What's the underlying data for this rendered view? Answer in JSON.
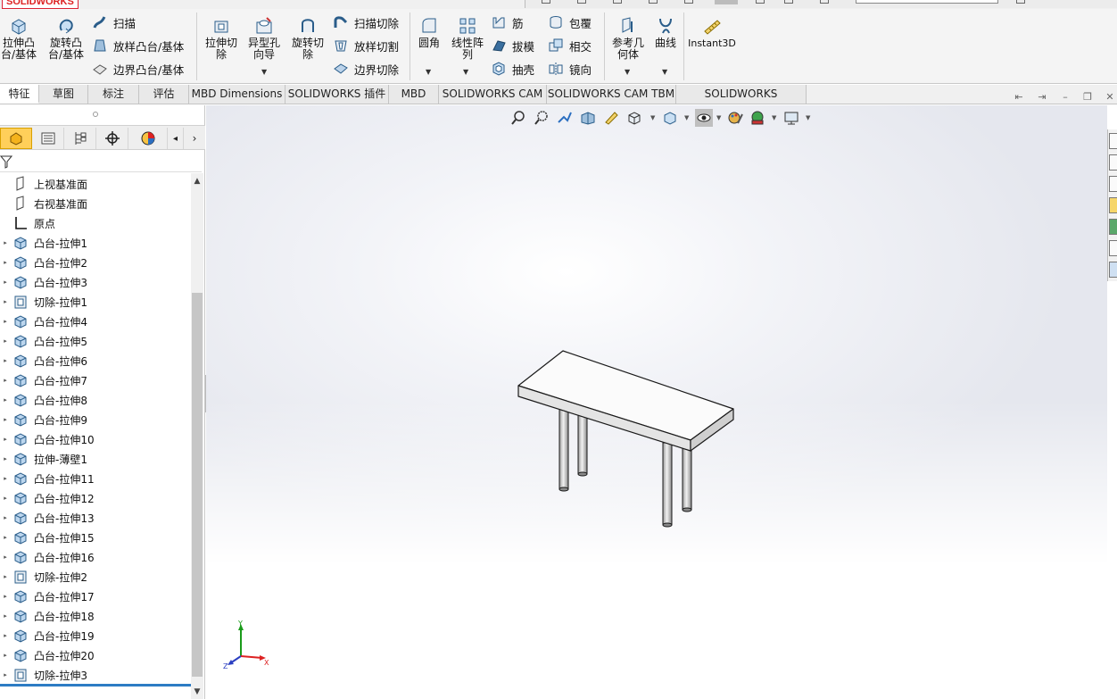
{
  "app": {
    "logo_text": "SOLIDWORKS"
  },
  "commands": {
    "extrude_boss": [
      "拉伸凸",
      "台/基体"
    ],
    "revolve_boss": [
      "旋转凸",
      "台/基体"
    ],
    "sweep": "扫描",
    "loft_boss": "放样凸台/基体",
    "boundary_boss": "边界凸台/基体",
    "extrude_cut": [
      "拉伸切",
      "除"
    ],
    "hole_wizard": [
      "异型孔",
      "向导"
    ],
    "revolve_cut": [
      "旋转切",
      "除"
    ],
    "swept_cut": "扫描切除",
    "lofted_cut": "放样切割",
    "boundary_cut": "边界切除",
    "fillet": "圆角",
    "linear_pattern": [
      "线性阵",
      "列"
    ],
    "rib": "筋",
    "draft": "拔模",
    "shell": "抽壳",
    "wrap": "包覆",
    "intersect": "相交",
    "mirror": "镜向",
    "ref_geometry": [
      "参考几",
      "何体"
    ],
    "curves": "曲线",
    "instant3d": "Instant3D"
  },
  "tabs": [
    "特征",
    "草图",
    "标注",
    "评估",
    "MBD Dimensions",
    "SOLIDWORKS 插件",
    "MBD",
    "SOLIDWORKS CAM",
    "SOLIDWORKS CAM TBM",
    "SOLIDWORKS Inspection"
  ],
  "active_tab": "特征",
  "feature_tree": [
    {
      "label": "上视基准面",
      "icon": "plane-icon"
    },
    {
      "label": "右视基准面",
      "icon": "plane-icon"
    },
    {
      "label": "原点",
      "icon": "origin-icon"
    },
    {
      "label": "凸台-拉伸1",
      "icon": "boss-extrude-icon"
    },
    {
      "label": "凸台-拉伸2",
      "icon": "boss-extrude-icon"
    },
    {
      "label": "凸台-拉伸3",
      "icon": "boss-extrude-icon"
    },
    {
      "label": "切除-拉伸1",
      "icon": "cut-extrude-icon"
    },
    {
      "label": "凸台-拉伸4",
      "icon": "boss-extrude-icon"
    },
    {
      "label": "凸台-拉伸5",
      "icon": "boss-extrude-icon"
    },
    {
      "label": "凸台-拉伸6",
      "icon": "boss-extrude-icon"
    },
    {
      "label": "凸台-拉伸7",
      "icon": "boss-extrude-icon"
    },
    {
      "label": "凸台-拉伸8",
      "icon": "boss-extrude-icon"
    },
    {
      "label": "凸台-拉伸9",
      "icon": "boss-extrude-icon"
    },
    {
      "label": "凸台-拉伸10",
      "icon": "boss-extrude-icon"
    },
    {
      "label": "拉伸-薄壁1",
      "icon": "boss-extrude-icon"
    },
    {
      "label": "凸台-拉伸11",
      "icon": "boss-extrude-icon"
    },
    {
      "label": "凸台-拉伸12",
      "icon": "boss-extrude-icon"
    },
    {
      "label": "凸台-拉伸13",
      "icon": "boss-extrude-icon"
    },
    {
      "label": "凸台-拉伸15",
      "icon": "boss-extrude-icon"
    },
    {
      "label": "凸台-拉伸16",
      "icon": "boss-extrude-icon"
    },
    {
      "label": "切除-拉伸2",
      "icon": "cut-extrude-icon"
    },
    {
      "label": "凸台-拉伸17",
      "icon": "boss-extrude-icon"
    },
    {
      "label": "凸台-拉伸18",
      "icon": "boss-extrude-icon"
    },
    {
      "label": "凸台-拉伸19",
      "icon": "boss-extrude-icon"
    },
    {
      "label": "凸台-拉伸20",
      "icon": "boss-extrude-icon"
    },
    {
      "label": "切除-拉伸3",
      "icon": "cut-extrude-icon"
    }
  ],
  "triad": {
    "x": "X",
    "y": "Y",
    "z": "Z"
  },
  "colors": {
    "accent": "#2d7cc4",
    "active_panel_tab": "#ffcf5a",
    "model_edge": "#1a1a1a"
  }
}
